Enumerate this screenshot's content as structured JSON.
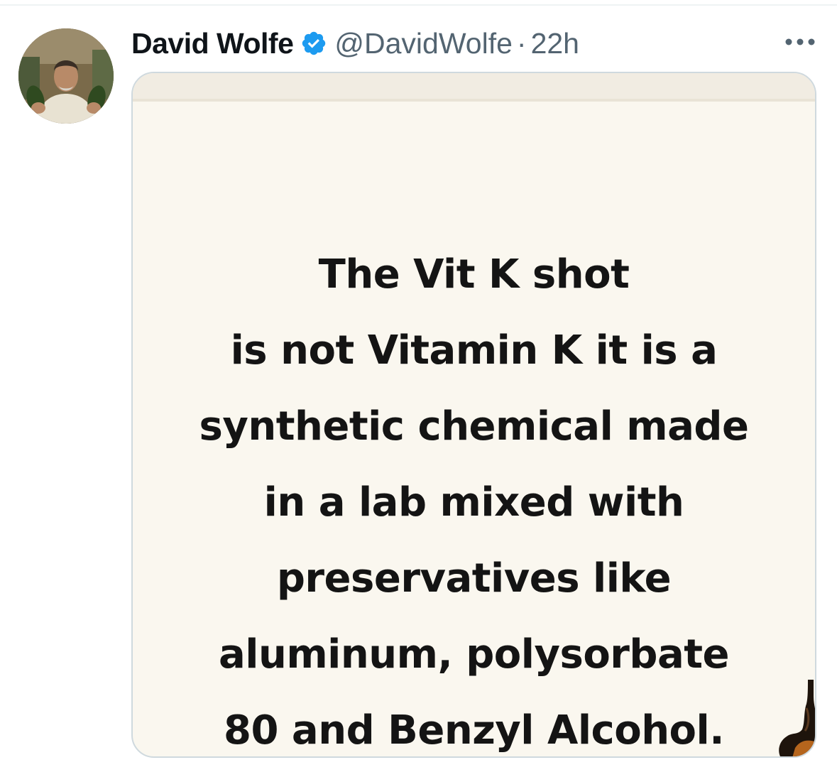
{
  "tweet": {
    "author": {
      "display_name": "David Wolfe",
      "verified": true,
      "handle": "@DavidWolfe",
      "separator": "·",
      "time": "22h"
    },
    "more_icon": "ellipsis-icon",
    "media": {
      "text_lines": [
        "The Vit K shot",
        "is not Vitamin K it is a",
        "synthetic chemical made",
        "in a lab mixed with",
        "preservatives like",
        "aluminum, polysorbate",
        "80 and Benzyl Alcohol."
      ],
      "background_color": "#faf7ef"
    }
  },
  "colors": {
    "name": "#0f1419",
    "secondary": "#536471",
    "verified_blue": "#1d9bf0",
    "border": "#cfd9de"
  }
}
